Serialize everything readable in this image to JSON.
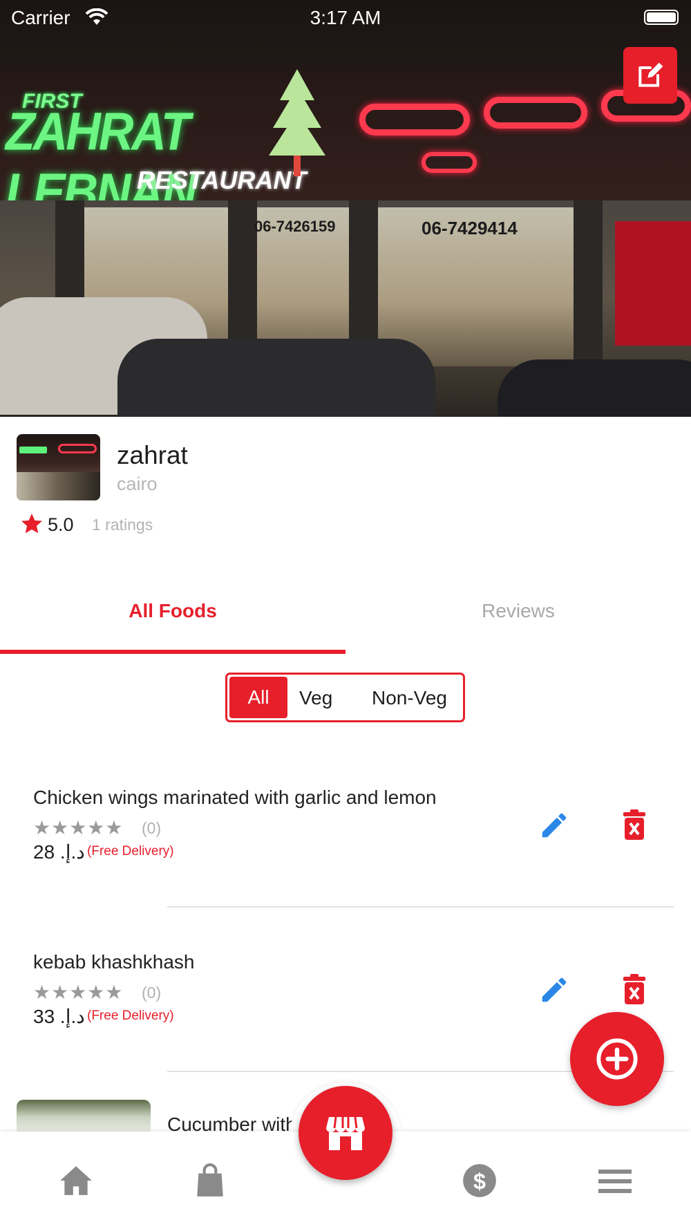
{
  "status_bar": {
    "carrier": "Carrier",
    "time": "3:17 AM"
  },
  "hero": {
    "icon": "edit-icon"
  },
  "restaurant": {
    "name": "zahrat",
    "city": "cairo",
    "rating": "5.0",
    "ratings_count": "1 ratings"
  },
  "tabs": [
    {
      "label": "All Foods",
      "active": true
    },
    {
      "label": "Reviews",
      "active": false
    }
  ],
  "filter": {
    "options": [
      "All",
      "Veg",
      "Non-Veg"
    ],
    "selected": "All"
  },
  "foods": [
    {
      "title": "Chicken wings marinated with garlic and lemon",
      "stars": "★★★★★",
      "count": "(0)",
      "price": "28 .د.إ",
      "delivery": "(Free Delivery)"
    },
    {
      "title": "kebab khashkhash",
      "stars": "★★★★★",
      "count": "(0)",
      "price": "33 .د.إ",
      "delivery": "(Free Delivery)"
    },
    {
      "title": "Cucumber with"
    }
  ],
  "colors": {
    "accent": "#e61f2b",
    "edit_icon": "#2a87e8",
    "muted": "#b3b3b3"
  },
  "bottom_nav": {
    "items": [
      "home-icon",
      "shopping-bag-icon",
      "store-icon",
      "dollar-icon",
      "menu-icon"
    ]
  }
}
